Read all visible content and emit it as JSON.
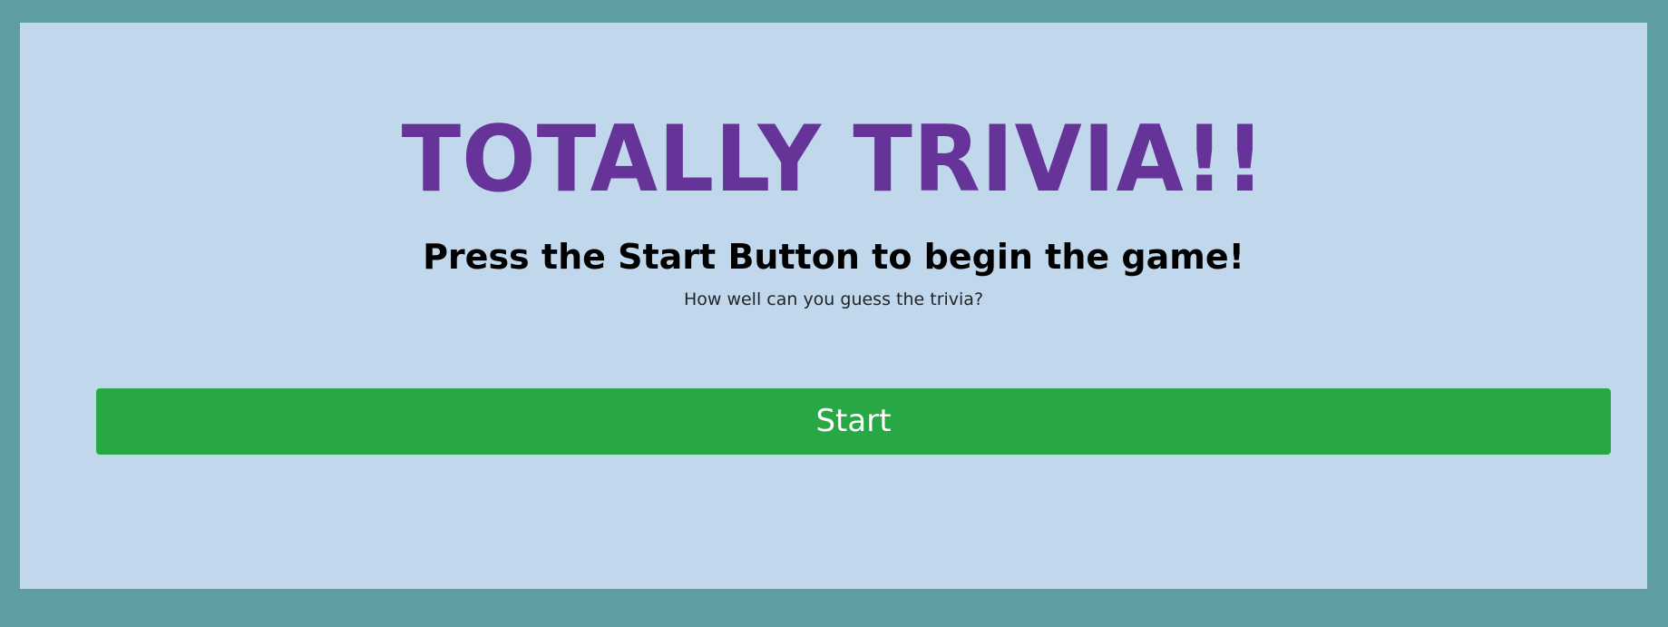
{
  "game": {
    "title": "TOTALLY TRIVIA!!",
    "heading": "Press the Start Button to begin the game!",
    "tagline": "How well can you guess the trivia?",
    "start_label": "Start"
  },
  "colors": {
    "background": "#5f9ea0",
    "panel": "#c1d7eb",
    "title": "#663399",
    "start_button": "#28a745",
    "start_button_text": "#ffffff"
  }
}
